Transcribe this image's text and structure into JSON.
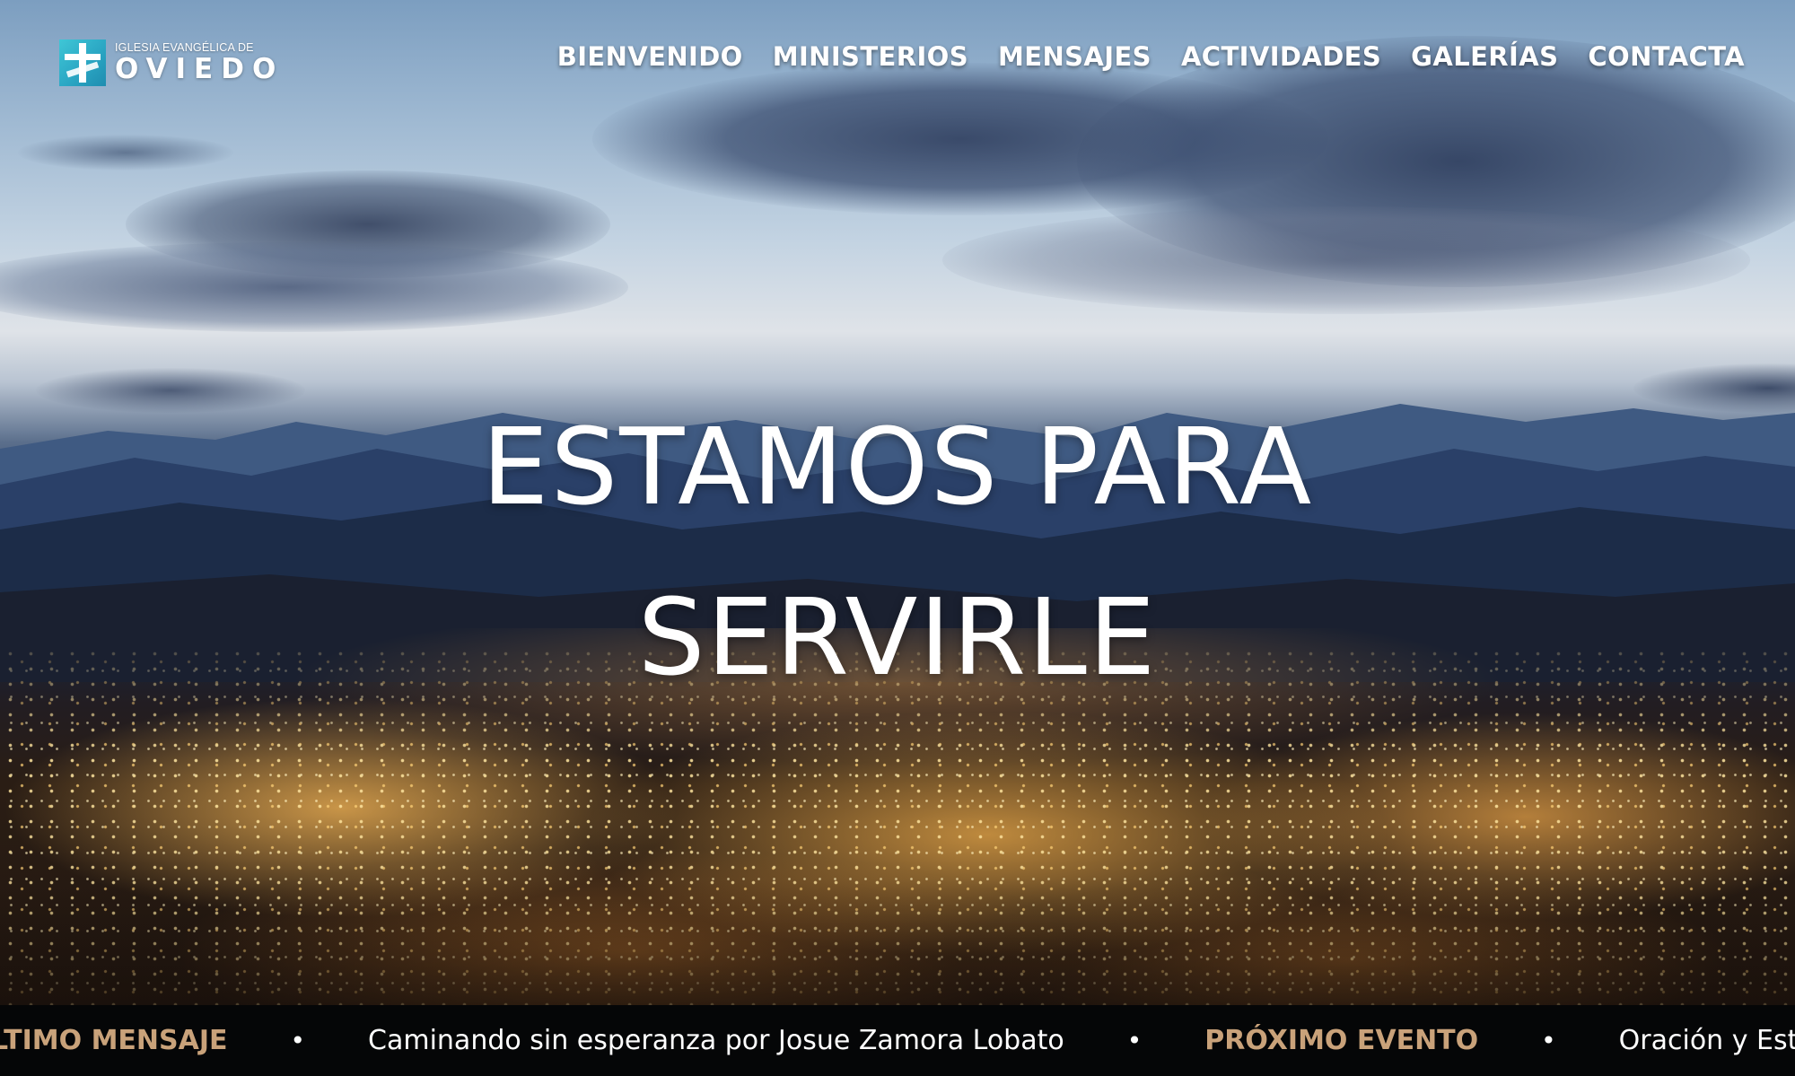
{
  "brand": {
    "line1": "IGLESIA EVANGÉLICA DE",
    "line2": "OVIEDO",
    "accent_color": "#2fb8cf"
  },
  "nav": {
    "items": [
      {
        "label": "BIENVENIDO"
      },
      {
        "label": "MINISTERIOS"
      },
      {
        "label": "MENSAJES"
      },
      {
        "label": "ACTIVIDADES"
      },
      {
        "label": "GALERÍAS"
      },
      {
        "label": "CONTACTA"
      }
    ]
  },
  "hero": {
    "line1": "ESTAMOS PARA",
    "line2": "SERVIRLE"
  },
  "ticker": {
    "label_color": "#c9a27a",
    "separator": "•",
    "latest_label": "LTIMO MENSAJE",
    "latest_text": "Caminando sin esperanza por Josue Zamora Lobato",
    "next_label": "PRÓXIMO EVENTO",
    "next_text": "Oración y Estudio el mi"
  }
}
